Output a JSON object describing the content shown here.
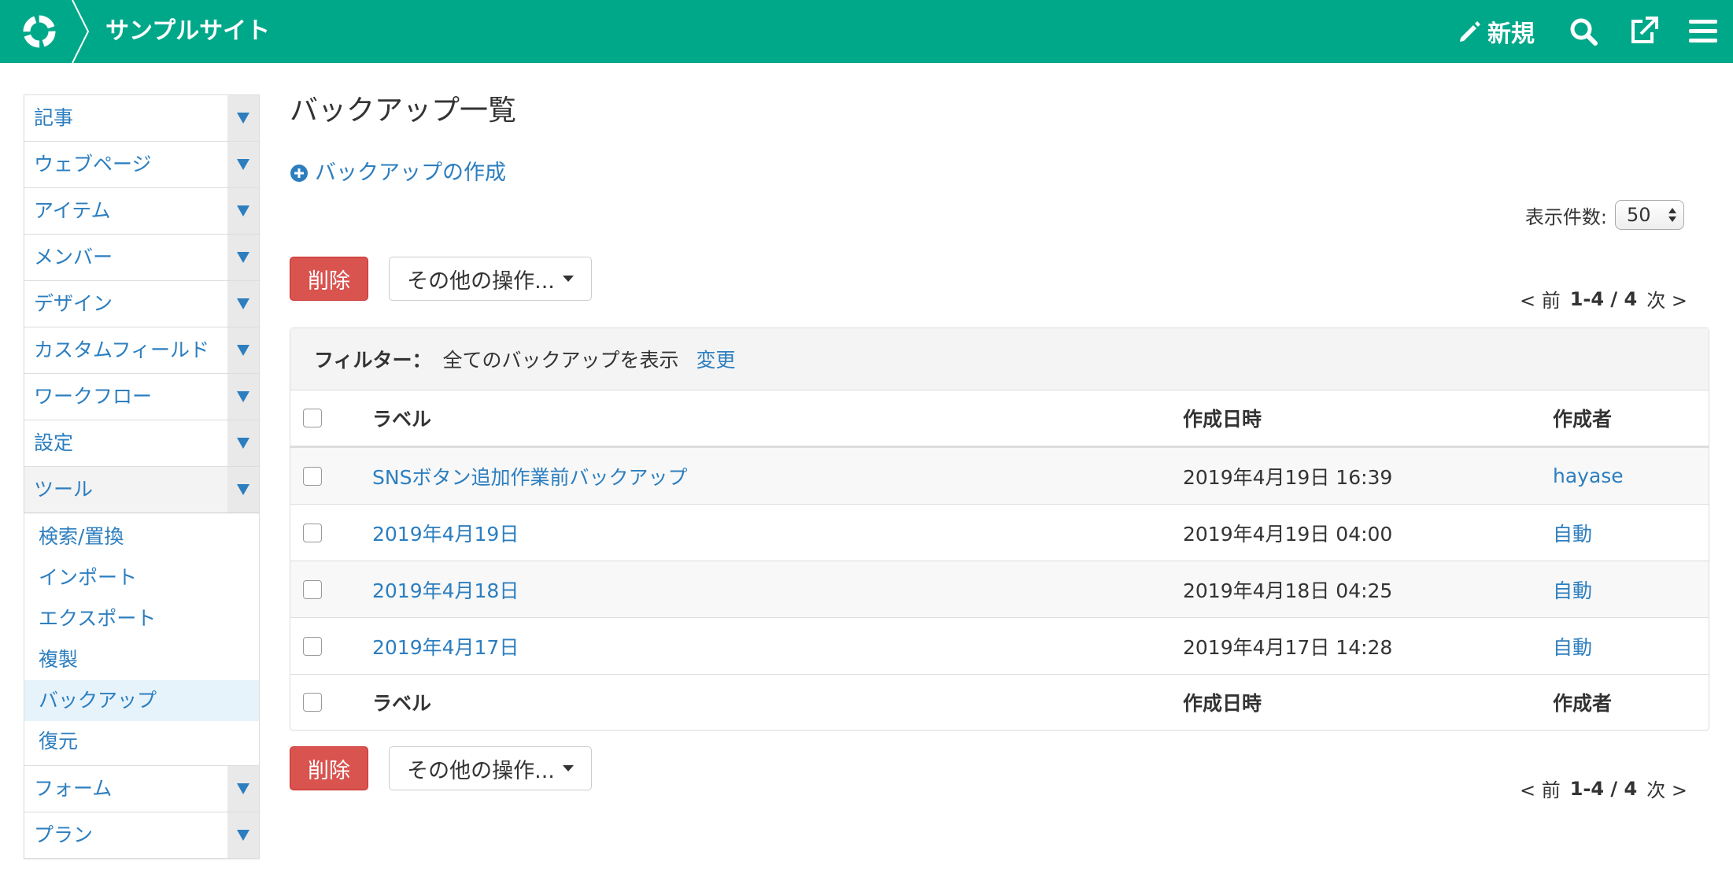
{
  "header": {
    "site_name": "サンプルサイト",
    "new_label": "新規",
    "brand_color": "#00a88a"
  },
  "sidebar": {
    "items": [
      {
        "label": "記事"
      },
      {
        "label": "ウェブページ"
      },
      {
        "label": "アイテム"
      },
      {
        "label": "メンバー"
      },
      {
        "label": "デザイン"
      },
      {
        "label": "カスタムフィールド"
      },
      {
        "label": "ワークフロー"
      },
      {
        "label": "設定"
      },
      {
        "label": "ツール"
      },
      {
        "label": "フォーム"
      },
      {
        "label": "プラン"
      }
    ],
    "tools_submenu": [
      {
        "label": "検索/置換"
      },
      {
        "label": "インポート"
      },
      {
        "label": "エクスポート"
      },
      {
        "label": "複製"
      },
      {
        "label": "バックアップ"
      },
      {
        "label": "復元"
      }
    ]
  },
  "main": {
    "title": "バックアップ一覧",
    "create_link": "バックアップの作成",
    "per_page_label": "表示件数:",
    "per_page_value": "50",
    "delete_label": "削除",
    "more_actions_label": "その他の操作...",
    "pager": {
      "prev": "< 前",
      "range": "1-4 / 4",
      "next": "次 >"
    },
    "filter": {
      "label": "フィルター：",
      "value": "全てのバックアップを表示",
      "change": "変更"
    },
    "table": {
      "columns": [
        "ラベル",
        "作成日時",
        "作成者"
      ],
      "rows": [
        {
          "label": "SNSボタン追加作業前バックアップ",
          "date": "2019年4月19日 16:39",
          "author": "hayase"
        },
        {
          "label": "2019年4月19日",
          "date": "2019年4月19日 04:00",
          "author": "自動"
        },
        {
          "label": "2019年4月18日",
          "date": "2019年4月18日 04:25",
          "author": "自動"
        },
        {
          "label": "2019年4月17日",
          "date": "2019年4月17日 14:28",
          "author": "自動"
        }
      ]
    }
  }
}
